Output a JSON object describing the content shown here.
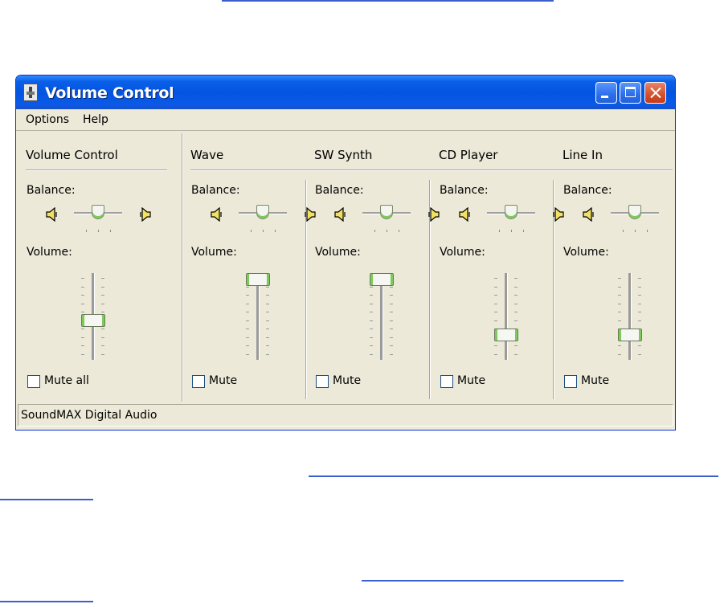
{
  "window": {
    "title": "Volume Control"
  },
  "menu": [
    "Options",
    "Help"
  ],
  "labels": {
    "balance": "Balance:",
    "volume": "Volume:"
  },
  "channels": [
    {
      "name": "Volume Control",
      "mute_label": "Mute all",
      "volume": 0.45,
      "balance": 0.5,
      "muted": false
    },
    {
      "name": "Wave",
      "mute_label": "Mute",
      "volume": 1.0,
      "balance": 0.5,
      "muted": false
    },
    {
      "name": "SW Synth",
      "mute_label": "Mute",
      "volume": 1.0,
      "balance": 0.5,
      "muted": false
    },
    {
      "name": "CD Player",
      "mute_label": "Mute",
      "volume": 0.25,
      "balance": 0.5,
      "muted": false
    },
    {
      "name": "Line In",
      "mute_label": "Mute",
      "volume": 0.25,
      "balance": 0.5,
      "muted": false
    }
  ],
  "status": "SoundMAX Digital Audio",
  "colors": {
    "titlebar": "#0454e0",
    "window_bg": "#ece9d8",
    "thumb_accent": "#7ccb5a",
    "link": "#3a5fcd"
  },
  "icons": [
    "app-icon",
    "minimize-icon",
    "maximize-icon",
    "close-icon",
    "speaker-left-icon",
    "speaker-right-icon"
  ]
}
